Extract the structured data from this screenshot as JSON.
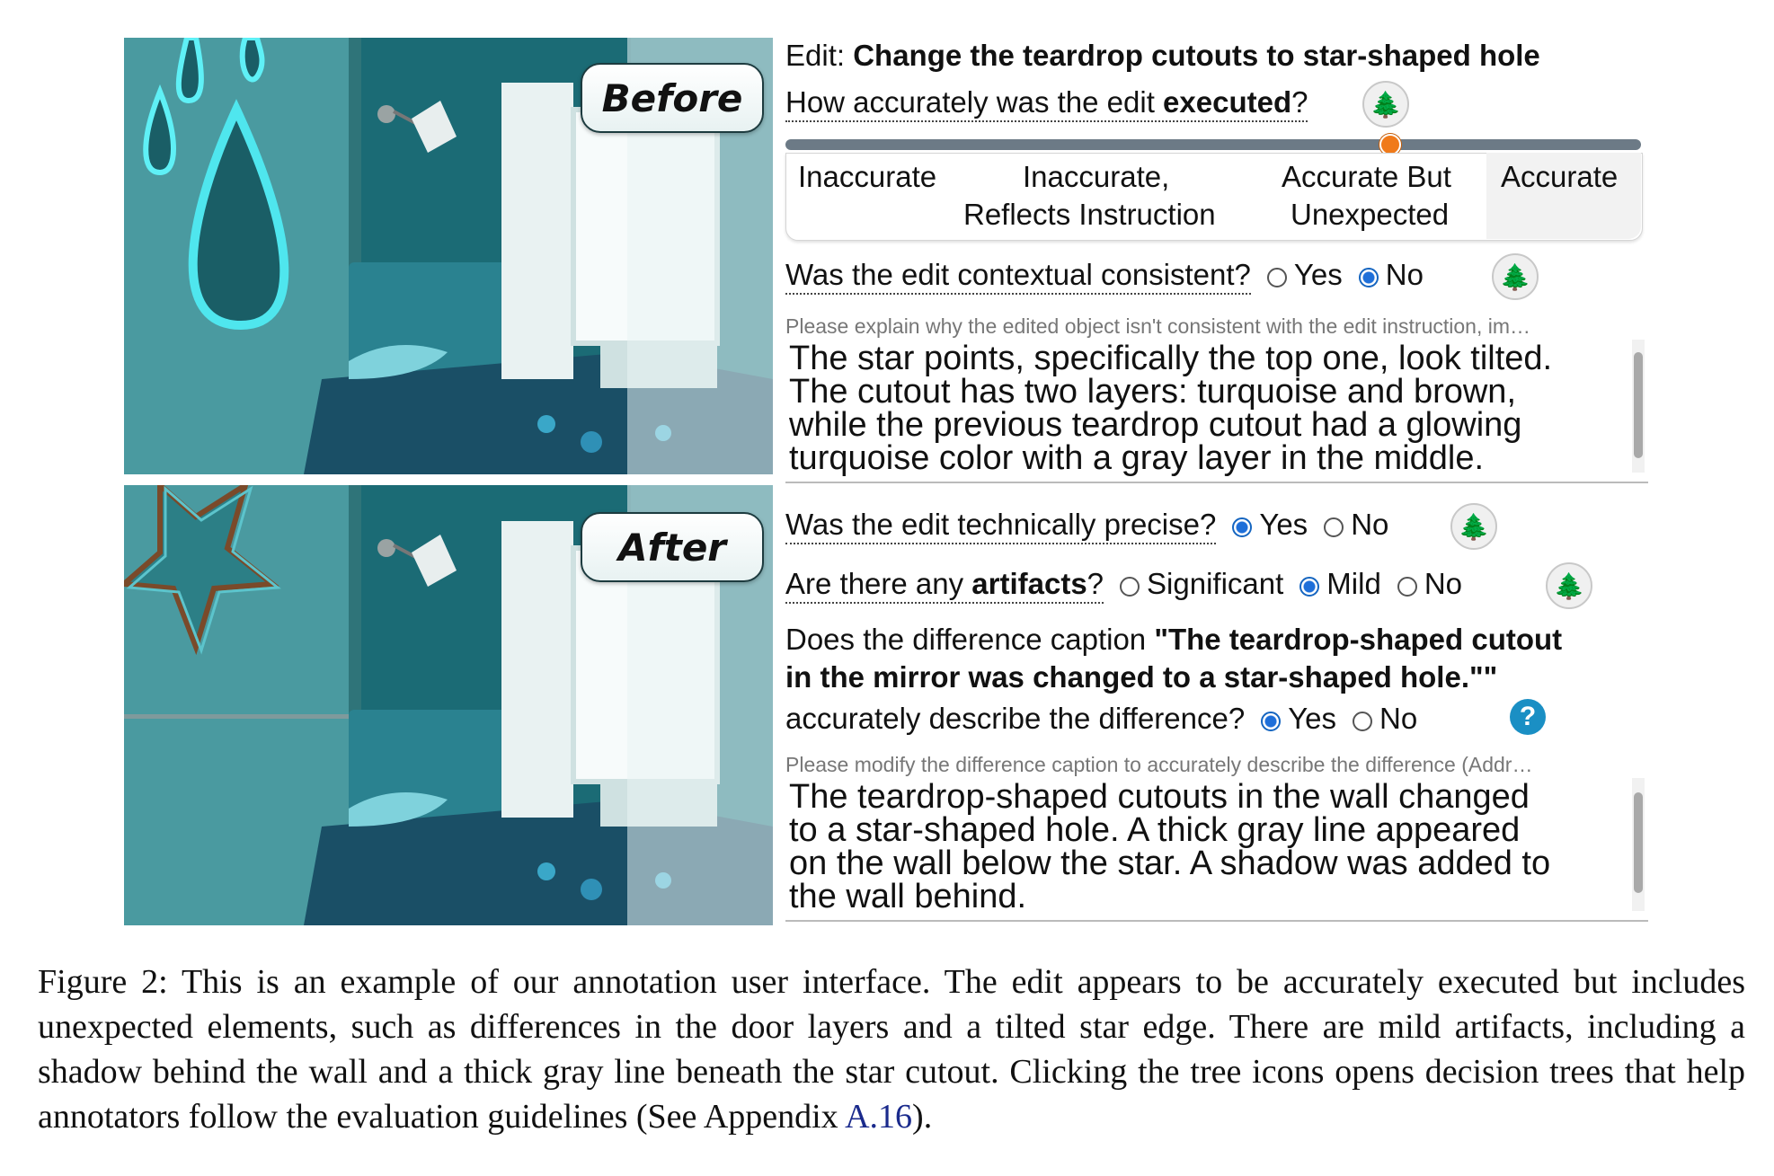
{
  "images": {
    "before_label": "Before",
    "after_label": "After"
  },
  "edit": {
    "prefix": "Edit: ",
    "instruction": "Change the teardrop cutouts to star-shaped hole"
  },
  "q_accuracy": {
    "text_a": "How accurately was the edit ",
    "text_b": "executed",
    "text_c": "?",
    "scale": [
      "Inaccurate",
      "Inaccurate,",
      "Reflects Instruction",
      "Accurate But",
      "Unexpected",
      "Accurate"
    ],
    "selected_index": 2
  },
  "q_context": {
    "text": "Was the edit contextual consistent?",
    "options": [
      "Yes",
      "No"
    ],
    "selected": "No",
    "placeholder": "Please explain why the edited object isn't consistent with the edit instruction, im…",
    "answer_lines": [
      "The star points, specifically the top one, look tilted.",
      "The cutout has two layers: turquoise and brown,",
      "while the previous teardrop cutout had a glowing",
      "turquoise color with a gray layer in the middle."
    ]
  },
  "q_precise": {
    "text": "Was the edit technically precise?",
    "options": [
      "Yes",
      "No"
    ],
    "selected": "Yes"
  },
  "q_artifacts": {
    "text_a": "Are there any ",
    "text_b": "artifacts",
    "text_c": "?",
    "options": [
      "Significant",
      "Mild",
      "No"
    ],
    "selected": "Mild"
  },
  "q_caption": {
    "text_a": "Does the difference caption ",
    "quote_line1": "\"The teardrop-shaped cutout",
    "quote_line2": "in the mirror was changed to a star-shaped hole.\"\"",
    "text_c": "accurately describe the difference?",
    "options": [
      "Yes",
      "No"
    ],
    "selected": "Yes",
    "help_glyph": "?",
    "placeholder": "Please modify the difference caption to accurately describe the difference (Addr…",
    "answer_lines": [
      "The teardrop-shaped cutouts in the wall changed",
      "to a star-shaped hole. A thick gray line appeared",
      "on the wall below the star. A shadow was added to",
      "the wall behind."
    ]
  },
  "icons": {
    "tree": "tree-icon",
    "help": "help-icon"
  },
  "figure_caption": {
    "text": "Figure 2: This is an example of our annotation user interface. The edit appears to be accurately executed but includes unexpected elements, such as differences in the door layers and a tilted star edge. There are mild artifacts, including a shadow behind the wall and a thick gray line beneath the star cutout. Clicking the tree icons opens decision trees that help annotators follow the evaluation guidelines (See Appendix ",
    "link": "A.16",
    "end": ")."
  },
  "colors": {
    "accent_radio": "#1e6fd9",
    "slider_knob": "#f07a1a",
    "tree_green": "#0e7a2b",
    "help_blue": "#1a8fc4",
    "link": "#1a2a8c"
  }
}
